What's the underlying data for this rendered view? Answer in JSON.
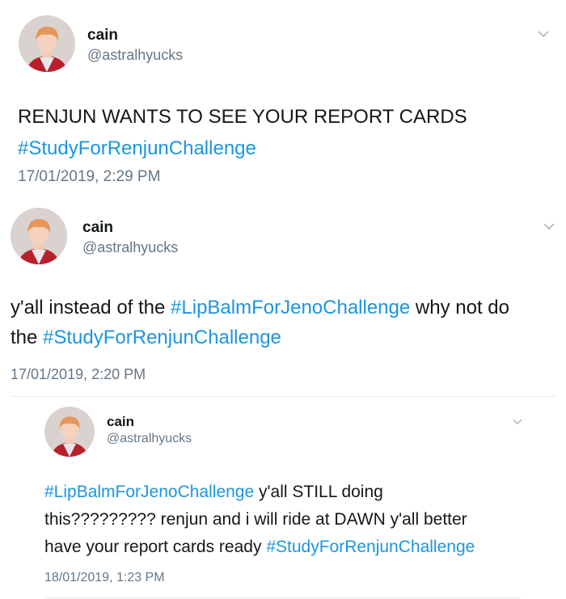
{
  "user": {
    "name": "cain",
    "handle": "@astralhyucks"
  },
  "tweets": [
    {
      "lines": [
        [
          {
            "text": "RENJUN WANTS TO SEE YOUR REPORT CARDS",
            "type": "text"
          }
        ],
        [
          {
            "text": "#StudyForRenjunChallenge",
            "type": "tag"
          }
        ]
      ],
      "timestamp": "17/01/2019, 2:29 PM"
    },
    {
      "lines": [
        [
          {
            "text": "y'all instead of the ",
            "type": "text"
          },
          {
            "text": "#LipBalmForJenoChallenge",
            "type": "tag"
          },
          {
            "text": " why not do",
            "type": "text"
          }
        ],
        [
          {
            "text": "the ",
            "type": "text"
          },
          {
            "text": "#StudyForRenjunChallenge",
            "type": "tag"
          }
        ]
      ],
      "timestamp": "17/01/2019, 2:20 PM"
    },
    {
      "lines": [
        [
          {
            "text": "#LipBalmForJenoChallenge",
            "type": "tag"
          },
          {
            "text": " y'all STILL doing",
            "type": "text"
          }
        ],
        [
          {
            "text": "this????????? renjun and i will ride at DAWN y'all better",
            "type": "text"
          }
        ],
        [
          {
            "text": "have your report cards ready ",
            "type": "text"
          },
          {
            "text": "#StudyForRenjunChallenge",
            "type": "tag"
          }
        ]
      ],
      "timestamp": "18/01/2019, 1:23 PM"
    }
  ],
  "icons": {
    "avatar": "avatar-photo",
    "menu": "chevron-down-icon"
  },
  "colors": {
    "hashtag": "#1b95e0",
    "secondary_text": "#657786",
    "divider": "#e6ecf0"
  }
}
